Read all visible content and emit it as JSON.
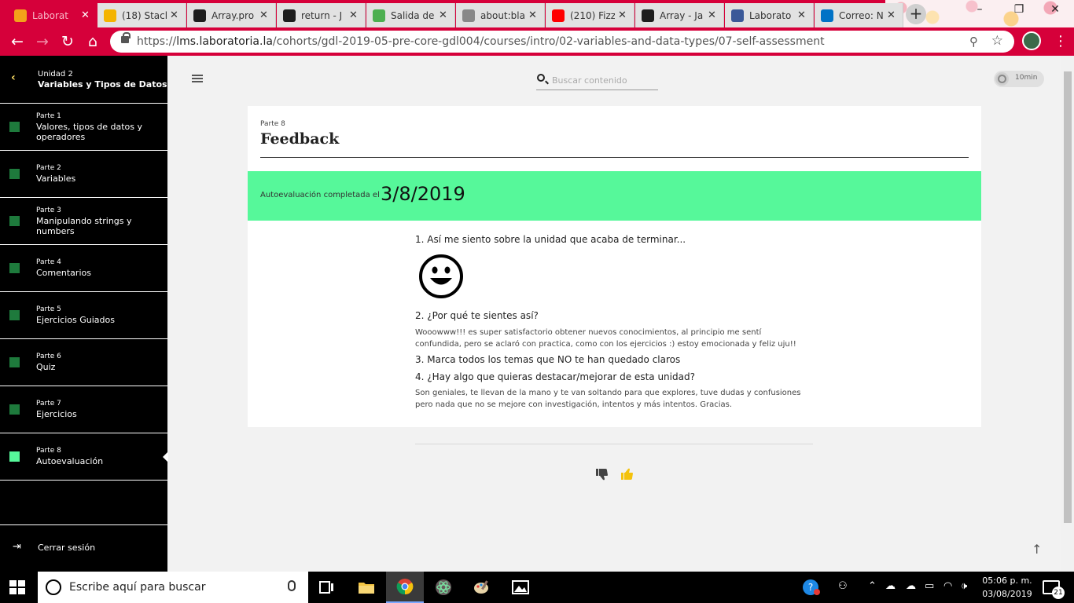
{
  "browser": {
    "tabs": [
      {
        "title": "Laborat",
        "favicon": "laboratoria-icon",
        "favicon_color": "#f3a21a"
      },
      {
        "title": "(18) Stack",
        "favicon": "stackoverflow-icon",
        "favicon_color": "#f4b400"
      },
      {
        "title": "Array.pro",
        "favicon": "mdn-icon",
        "favicon_color": "#1d1d1d"
      },
      {
        "title": "return - J",
        "favicon": "mdn-icon",
        "favicon_color": "#1d1d1d"
      },
      {
        "title": "Salida de",
        "favicon": "w3-icon",
        "favicon_color": "#4caf50"
      },
      {
        "title": "about:bla",
        "favicon": "globe-icon",
        "favicon_color": "#888888"
      },
      {
        "title": "(210) Fizz",
        "favicon": "youtube-icon",
        "favicon_color": "#ff0000"
      },
      {
        "title": "Array - Ja",
        "favicon": "mdn-icon",
        "favicon_color": "#1d1d1d"
      },
      {
        "title": "Laborato",
        "favicon": "facebook-icon",
        "favicon_color": "#3b5998"
      },
      {
        "title": "Correo: N",
        "favicon": "outlook-icon",
        "favicon_color": "#0072c6"
      }
    ],
    "url_prefix": "https://",
    "url_host": "lms.laboratoria.la",
    "url_path": "/cohorts/gdl-2019-05-pre-core-gdl004/courses/intro/02-variables-and-data-types/07-self-assessment",
    "accent_color": "#d6003a"
  },
  "sidebar": {
    "unit_kicker": "Unidad 2",
    "unit_title": "Variables y Tipos de Datos",
    "parts": [
      {
        "kicker": "Parte 1",
        "title": "Valores, tipos de datos y operadores"
      },
      {
        "kicker": "Parte 2",
        "title": "Variables"
      },
      {
        "kicker": "Parte 3",
        "title": "Manipulando strings y numbers"
      },
      {
        "kicker": "Parte 4",
        "title": "Comentarios"
      },
      {
        "kicker": "Parte 5",
        "title": "Ejercicios Guiados"
      },
      {
        "kicker": "Parte 6",
        "title": "Quiz"
      },
      {
        "kicker": "Parte 7",
        "title": "Ejercicios"
      },
      {
        "kicker": "Parte 8",
        "title": "Autoevaluación"
      }
    ],
    "logout_label": "Cerrar sesión"
  },
  "header": {
    "search_placeholder": "Buscar contenido",
    "duration": "10min"
  },
  "card": {
    "kicker": "Parte 8",
    "title": "Feedback",
    "completed_label": "Autoevaluación completada el",
    "completed_date": "3/8/2019",
    "banner_color": "#56f89a",
    "q1": "1. Así me siento sobre la unidad que acaba de terminar...",
    "q1_answer_icon": "smiley-icon",
    "q2": "2. ¿Por qué te sientes así?",
    "a2": "Wooowww!!! es super satisfactorio obtener nuevos conocimientos, al principio me sentí confundida, pero se aclaró con practica, como con los ejercicios :) estoy emocionada y feliz uju!!",
    "q3": "3. Marca todos los temas que NO te han quedado claros",
    "q4": "4. ¿Hay algo que quieras destacar/mejorar de esta unidad?",
    "a4": "Son geniales, te llevan de la mano y te van soltando para que explores, tuve dudas y confusiones pero nada que no se mejore con investigación, intentos y más intentos. Gracias."
  },
  "taskbar": {
    "search_text": "Escribe aquí para buscar",
    "time": "05:06 p. m.",
    "date": "03/08/2019",
    "notifications": "21"
  }
}
